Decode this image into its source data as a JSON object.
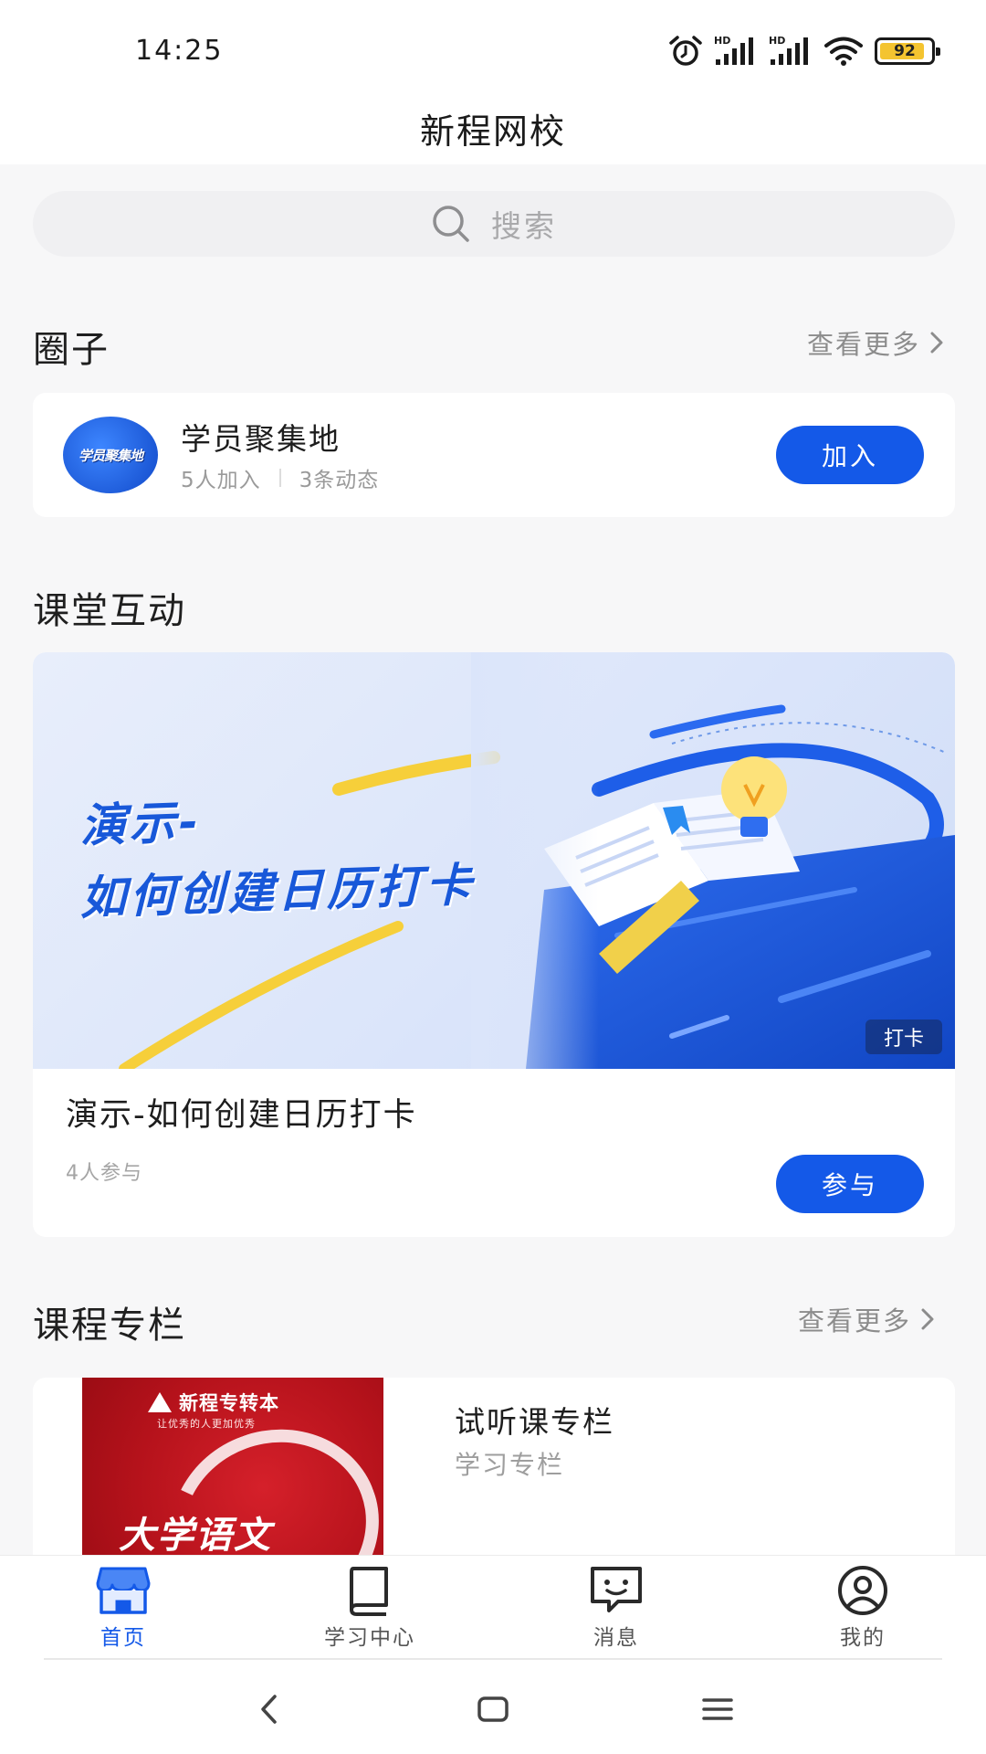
{
  "status_bar": {
    "time": "14:25",
    "icons": [
      "alarm-icon",
      "hd-signal-icon",
      "hd-signal-icon",
      "wifi-icon"
    ],
    "battery": "92"
  },
  "header": {
    "title": "新程网校"
  },
  "search": {
    "placeholder": "搜索",
    "icon": "search-icon"
  },
  "circles": {
    "title": "圈子",
    "more": "查看更多",
    "items": [
      {
        "avatar_text": "学员聚集地",
        "name": "学员聚集地",
        "members": "5人加入",
        "posts": "3条动态",
        "action": "加入"
      }
    ]
  },
  "interaction": {
    "title": "课堂互动",
    "items": [
      {
        "banner_line1": "演示-",
        "banner_line2": "如何创建日历打卡",
        "tag": "打卡",
        "name": "演示-如何创建日历打卡",
        "participants": "4人参与",
        "action": "参与"
      }
    ]
  },
  "columns": {
    "title": "课程专栏",
    "more": "查看更多",
    "items": [
      {
        "cover_brand": "新程专转本",
        "cover_slogan": "让优秀的人更加优秀",
        "cover_subject": "大学语文",
        "name": "试听课专栏",
        "subtitle": "学习专栏"
      }
    ]
  },
  "bottom_nav": {
    "items": [
      {
        "label": "首页",
        "icon": "home-store-icon",
        "active": true
      },
      {
        "label": "学习中心",
        "icon": "book-icon",
        "active": false
      },
      {
        "label": "消息",
        "icon": "message-icon",
        "active": false
      },
      {
        "label": "我的",
        "icon": "profile-icon",
        "active": false
      }
    ]
  },
  "system_nav": {
    "icons": [
      "back-icon",
      "home-icon",
      "menu-icon"
    ]
  },
  "colors": {
    "accent": "#1459e8",
    "background": "#f7f7f8",
    "card": "#ffffff"
  }
}
